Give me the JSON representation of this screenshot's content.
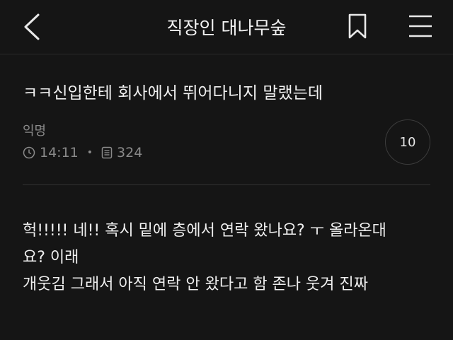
{
  "header": {
    "title": "직장인 대나무숲",
    "icons": {
      "back": "chevron-left-icon",
      "bookmark": "bookmark-icon",
      "menu": "hamburger-menu-icon"
    }
  },
  "post": {
    "title": "ㅋㅋ신입한테 회사에서 뛰어다니지 말랬는데",
    "author": "익명",
    "time": "14:11",
    "views": "324",
    "count_badge": "10",
    "body_lines": [
      "헉!!!!! 네!! 혹시 밑에 층에서 연락 왔나요? ㅜ 올라온대",
      "요? 이래",
      "개웃김 그래서 아직 연락 안 왔다고 함 존나 웃겨 진짜"
    ]
  },
  "colors": {
    "background": "#151515",
    "text": "#ececec",
    "muted": "#8a8a8a"
  }
}
